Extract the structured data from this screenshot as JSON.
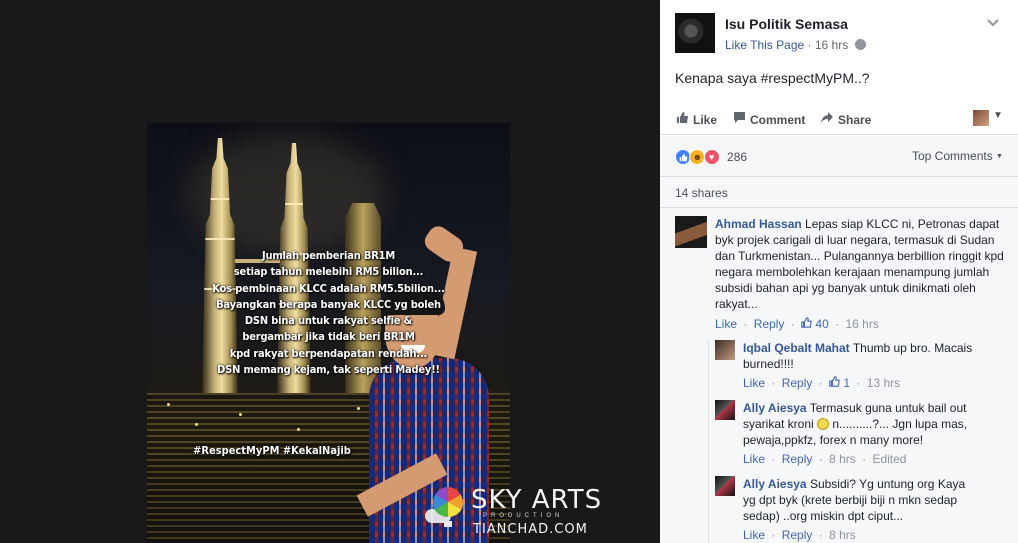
{
  "photo": {
    "overlay_lines": [
      "Jumlah pemberian BR1M",
      "setiap tahun melebihi RM5 bilion...",
      "Kos pembinaan KLCC adalah RM5.5bilion...",
      "Bayangkan berapa banyak KLCC yg boleh",
      "DSN bina untuk rakyat selfie &",
      "bergambar jika tidak beri BR1M",
      "kpd rakyat berpendapatan rendah...",
      "DSN memang kejam, tak seperti Madey!!"
    ],
    "hashtags": "#RespectMyPM #KekalNajib",
    "watermark": {
      "title": "SKY ARTS",
      "subtitle": "PRODUCTION",
      "site": "TIANCHAD.COM"
    }
  },
  "post": {
    "page_name": "Isu Politik Semasa",
    "like_page": "Like This Page",
    "separator": "·",
    "time": "16 hrs",
    "text": "Kenapa saya #respectMyPM..?",
    "actions": {
      "like": "Like",
      "comment": "Comment",
      "share": "Share"
    },
    "reaction_count": "286",
    "top_comments": "Top Comments",
    "shares": "14 shares"
  },
  "comments": [
    {
      "author": "Ahmad Hassan",
      "text": "Lepas siap KLCC ni, Petronas dapat byk projek carigali di luar negara, termasuk di Sudan dan Turkmenistan... Pulangannya berbillion ringgit kpd negara membolehkan kerajaan menampung jumlah subsidi bahan api yg banyak untuk dinikmati oleh rakyat...",
      "like": "Like",
      "reply": "Reply",
      "likes": "40",
      "time": "16 hrs"
    }
  ],
  "replies": [
    {
      "author": "Iqbal Qebalt Mahat",
      "text": "Thumb up bro. Macais burned!!!!",
      "like": "Like",
      "reply": "Reply",
      "likes": "1",
      "time": "13 hrs"
    },
    {
      "author": "Ally Aiesya",
      "text_a": "Termasuk guna untuk bail out syarikat kroni",
      "text_b": "n..........?... Jgn lupa mas, pewaja,ppkfz, forex n many more!",
      "like": "Like",
      "reply": "Reply",
      "time": "8 hrs",
      "edited": "Edited"
    },
    {
      "author": "Ally Aiesya",
      "text": "Subsidi? Yg untung org Kaya yg dpt byk (krete berbiji biji n mkn sedap sedap) ..org miskin dpt ciput...",
      "like": "Like",
      "reply": "Reply",
      "time": "8 hrs"
    }
  ],
  "colors": {
    "link": "#365899",
    "action_link": "#4267b2",
    "like_reaction": "#4080ff",
    "haha_reaction": "#f7b125",
    "love_reaction": "#f25268"
  },
  "icons": [
    "chevron-down-icon",
    "globe-icon",
    "thumbs-up-icon",
    "comment-icon",
    "share-icon",
    "like-reaction-icon",
    "haha-reaction-icon",
    "love-reaction-icon",
    "smiley-emoji-icon"
  ]
}
